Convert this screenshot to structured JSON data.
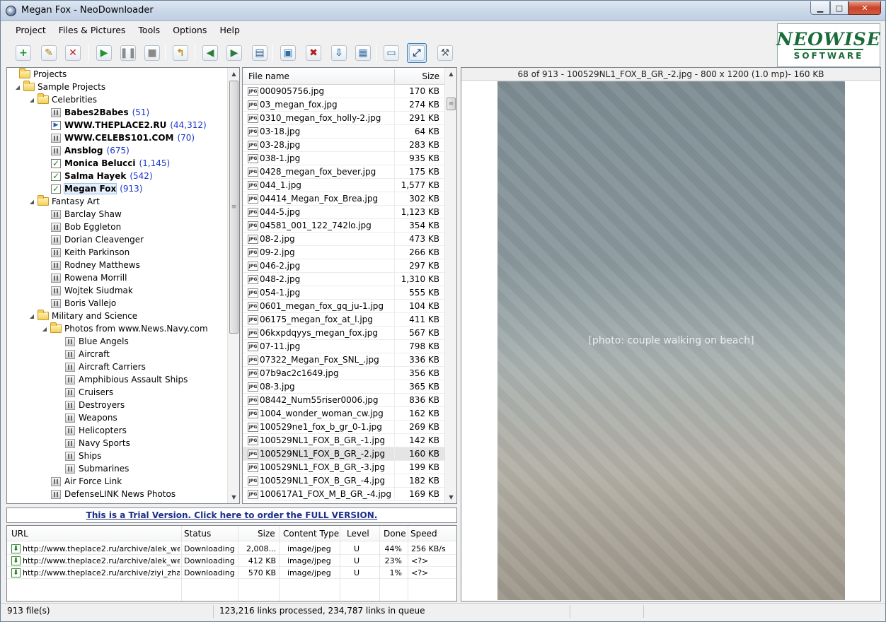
{
  "window": {
    "title": "Megan Fox - NeoDownloader",
    "min": "▁",
    "max": "□",
    "close": "✕"
  },
  "menu": [
    "Project",
    "Files & Pictures",
    "Tools",
    "Options",
    "Help"
  ],
  "toolbar": [
    {
      "name": "new-project-icon",
      "glyph": "+",
      "color": "#1f8f2a"
    },
    {
      "name": "edit-project-icon",
      "glyph": "✎",
      "color": "#b07a10"
    },
    {
      "name": "delete-project-icon",
      "glyph": "✕",
      "color": "#c02020"
    },
    {
      "name": "start-icon",
      "glyph": "▶",
      "color": "#22932e"
    },
    {
      "name": "pause-icon",
      "glyph": "❚❚",
      "color": "#8a8a8a"
    },
    {
      "name": "stop-icon",
      "glyph": "■",
      "color": "#8a8a8a"
    },
    {
      "name": "open-folder-icon",
      "glyph": "↰",
      "color": "#c08f10"
    },
    {
      "name": "back-icon",
      "glyph": "◀",
      "color": "#2b7d3a"
    },
    {
      "name": "forward-icon",
      "glyph": "▶",
      "color": "#2b7d3a"
    },
    {
      "name": "slideshow-icon",
      "glyph": "▤",
      "color": "#2f5f8f"
    },
    {
      "name": "view-image-icon",
      "glyph": "▣",
      "color": "#2f6fa8"
    },
    {
      "name": "delete-image-icon",
      "glyph": "✖",
      "color": "#b02020"
    },
    {
      "name": "save-image-icon",
      "glyph": "⇩",
      "color": "#2f6fa8"
    },
    {
      "name": "thumbnails-icon",
      "glyph": "▦",
      "color": "#3a6ea8"
    },
    {
      "name": "window-icon",
      "glyph": "▭",
      "color": "#2f6fa8"
    },
    {
      "name": "fit-image-icon",
      "glyph": "⤢",
      "color": "#1f4f8f"
    },
    {
      "name": "tools-icon",
      "glyph": "⚒",
      "color": "#555555"
    }
  ],
  "logo": {
    "line1": "NEOWISE",
    "line2": "SOFTWARE"
  },
  "tree": [
    {
      "label": "Projects",
      "level": 0,
      "icon": "folder",
      "exp": ""
    },
    {
      "label": "Sample Projects",
      "level": 1,
      "icon": "folder",
      "exp": "◢"
    },
    {
      "label": "Celebrities",
      "level": 2,
      "icon": "folder",
      "exp": "◢"
    },
    {
      "label": "Babes2Babes",
      "count": "(51)",
      "level": 3,
      "icon": "pause",
      "bold": true
    },
    {
      "label": "WWW.THEPLACE2.RU",
      "count": "(44,312)",
      "level": 3,
      "icon": "play",
      "bold": true
    },
    {
      "label": "WWW.CELEBS101.COM",
      "count": "(70)",
      "level": 3,
      "icon": "pause",
      "bold": true
    },
    {
      "label": "Ansblog",
      "count": "(675)",
      "level": 3,
      "icon": "pause",
      "bold": true
    },
    {
      "label": "Monica Belucci",
      "count": "(1,145)",
      "level": 3,
      "icon": "check",
      "bold": true
    },
    {
      "label": "Salma Hayek",
      "count": "(542)",
      "level": 3,
      "icon": "check",
      "bold": true
    },
    {
      "label": "Megan Fox",
      "count": "(913)",
      "level": 3,
      "icon": "check",
      "bold": true,
      "selected": true
    },
    {
      "label": "Fantasy Art",
      "level": 2,
      "icon": "folder",
      "exp": "◢"
    },
    {
      "label": "Barclay Shaw",
      "level": 3,
      "icon": "pause"
    },
    {
      "label": "Bob Eggleton",
      "level": 3,
      "icon": "pause"
    },
    {
      "label": "Dorian Cleavenger",
      "level": 3,
      "icon": "pause"
    },
    {
      "label": "Keith Parkinson",
      "level": 3,
      "icon": "pause"
    },
    {
      "label": "Rodney Matthews",
      "level": 3,
      "icon": "pause"
    },
    {
      "label": "Rowena Morrill",
      "level": 3,
      "icon": "pause"
    },
    {
      "label": "Wojtek Siudmak",
      "level": 3,
      "icon": "pause"
    },
    {
      "label": "Boris Vallejo",
      "level": 3,
      "icon": "pause"
    },
    {
      "label": "Military and Science",
      "level": 2,
      "icon": "folder",
      "exp": "◢"
    },
    {
      "label": "Photos from www.News.Navy.com",
      "level": 3,
      "icon": "folder",
      "exp": "◢"
    },
    {
      "label": "Blue Angels",
      "level": 4,
      "icon": "pause"
    },
    {
      "label": "Aircraft",
      "level": 4,
      "icon": "pause"
    },
    {
      "label": "Aircraft Carriers",
      "level": 4,
      "icon": "pause"
    },
    {
      "label": "Amphibious Assault Ships",
      "level": 4,
      "icon": "pause"
    },
    {
      "label": "Cruisers",
      "level": 4,
      "icon": "pause"
    },
    {
      "label": "Destroyers",
      "level": 4,
      "icon": "pause"
    },
    {
      "label": "Weapons",
      "level": 4,
      "icon": "pause"
    },
    {
      "label": "Helicopters",
      "level": 4,
      "icon": "pause"
    },
    {
      "label": "Navy Sports",
      "level": 4,
      "icon": "pause"
    },
    {
      "label": "Ships",
      "level": 4,
      "icon": "pause"
    },
    {
      "label": "Submarines",
      "level": 4,
      "icon": "pause"
    },
    {
      "label": "Air Force Link",
      "level": 3,
      "icon": "pause"
    },
    {
      "label": "DefenseLINK News Photos",
      "level": 3,
      "icon": "pause"
    }
  ],
  "files": {
    "header": {
      "name": "File name",
      "size": "Size"
    },
    "icon_text": "JPG",
    "rows": [
      {
        "name": "000905756.jpg",
        "size": "170 KB"
      },
      {
        "name": "03_megan_fox.jpg",
        "size": "274 KB"
      },
      {
        "name": "0310_megan_fox_holly-2.jpg",
        "size": "291 KB"
      },
      {
        "name": "03-18.jpg",
        "size": "64 KB"
      },
      {
        "name": "03-28.jpg",
        "size": "283 KB"
      },
      {
        "name": "038-1.jpg",
        "size": "935 KB"
      },
      {
        "name": "0428_megan_fox_bever.jpg",
        "size": "175 KB"
      },
      {
        "name": "044_1.jpg",
        "size": "1,577 KB"
      },
      {
        "name": "04414_Megan_Fox_Brea.jpg",
        "size": "302 KB"
      },
      {
        "name": "044-5.jpg",
        "size": "1,123 KB"
      },
      {
        "name": "04581_001_122_742lo.jpg",
        "size": "354 KB"
      },
      {
        "name": "08-2.jpg",
        "size": "473 KB"
      },
      {
        "name": "09-2.jpg",
        "size": "266 KB"
      },
      {
        "name": "046-2.jpg",
        "size": "297 KB"
      },
      {
        "name": "048-2.jpg",
        "size": "1,310 KB"
      },
      {
        "name": "054-1.jpg",
        "size": "555 KB"
      },
      {
        "name": "0601_megan_fox_gq_ju-1.jpg",
        "size": "104 KB"
      },
      {
        "name": "06175_megan_fox_at_l.jpg",
        "size": "411 KB"
      },
      {
        "name": "06kxpdqyys_megan_fox.jpg",
        "size": "567 KB"
      },
      {
        "name": "07-11.jpg",
        "size": "798 KB"
      },
      {
        "name": "07322_Megan_Fox_SNL_.jpg",
        "size": "336 KB"
      },
      {
        "name": "07b9ac2c1649.jpg",
        "size": "356 KB"
      },
      {
        "name": "08-3.jpg",
        "size": "365 KB"
      },
      {
        "name": "08442_Num55riser0006.jpg",
        "size": "836 KB"
      },
      {
        "name": "1004_wonder_woman_cw.jpg",
        "size": "162 KB"
      },
      {
        "name": "100529ne1_fox_b_gr_0-1.jpg",
        "size": "269 KB"
      },
      {
        "name": "100529NL1_FOX_B_GR_-1.jpg",
        "size": "142 KB"
      },
      {
        "name": "100529NL1_FOX_B_GR_-2.jpg",
        "size": "160 KB",
        "selected": true
      },
      {
        "name": "100529NL1_FOX_B_GR_-3.jpg",
        "size": "199 KB"
      },
      {
        "name": "100529NL1_FOX_B_GR_-4.jpg",
        "size": "182 KB"
      },
      {
        "name": "100617A1_FOX_M_B_GR_-4.jpg",
        "size": "169 KB"
      }
    ]
  },
  "viewer": {
    "caption": "68 of 913 - 100529NL1_FOX_B_GR_-2.jpg - 800 x 1200 (1.0 mp)- 160 KB",
    "photo_placeholder": "[photo: couple walking on beach]"
  },
  "trial": {
    "text": "This is a Trial Version. Click here to order the FULL VERSION."
  },
  "downloads": {
    "columns": [
      "URL",
      "Status",
      "Size",
      "Content Type",
      "Level",
      "Done",
      "Speed"
    ],
    "rows": [
      {
        "url": "http://www.theplace2.ru/archive/alek_we...",
        "status": "Downloading",
        "size": "2,008...",
        "type": "image/jpeg",
        "level": "U",
        "done": "44%",
        "speed": "256 KB/s"
      },
      {
        "url": "http://www.theplace2.ru/archive/alek_we...",
        "status": "Downloading",
        "size": "412 KB",
        "type": "image/jpeg",
        "level": "U",
        "done": "23%",
        "speed": "<?>"
      },
      {
        "url": "http://www.theplace2.ru/archive/ziyi_zha...",
        "status": "Downloading",
        "size": "570 KB",
        "type": "image/jpeg",
        "level": "U",
        "done": "1%",
        "speed": "<?>"
      }
    ]
  },
  "status": {
    "files": "913 file(s)",
    "links": "123,216 links processed, 234,787 links in queue"
  }
}
